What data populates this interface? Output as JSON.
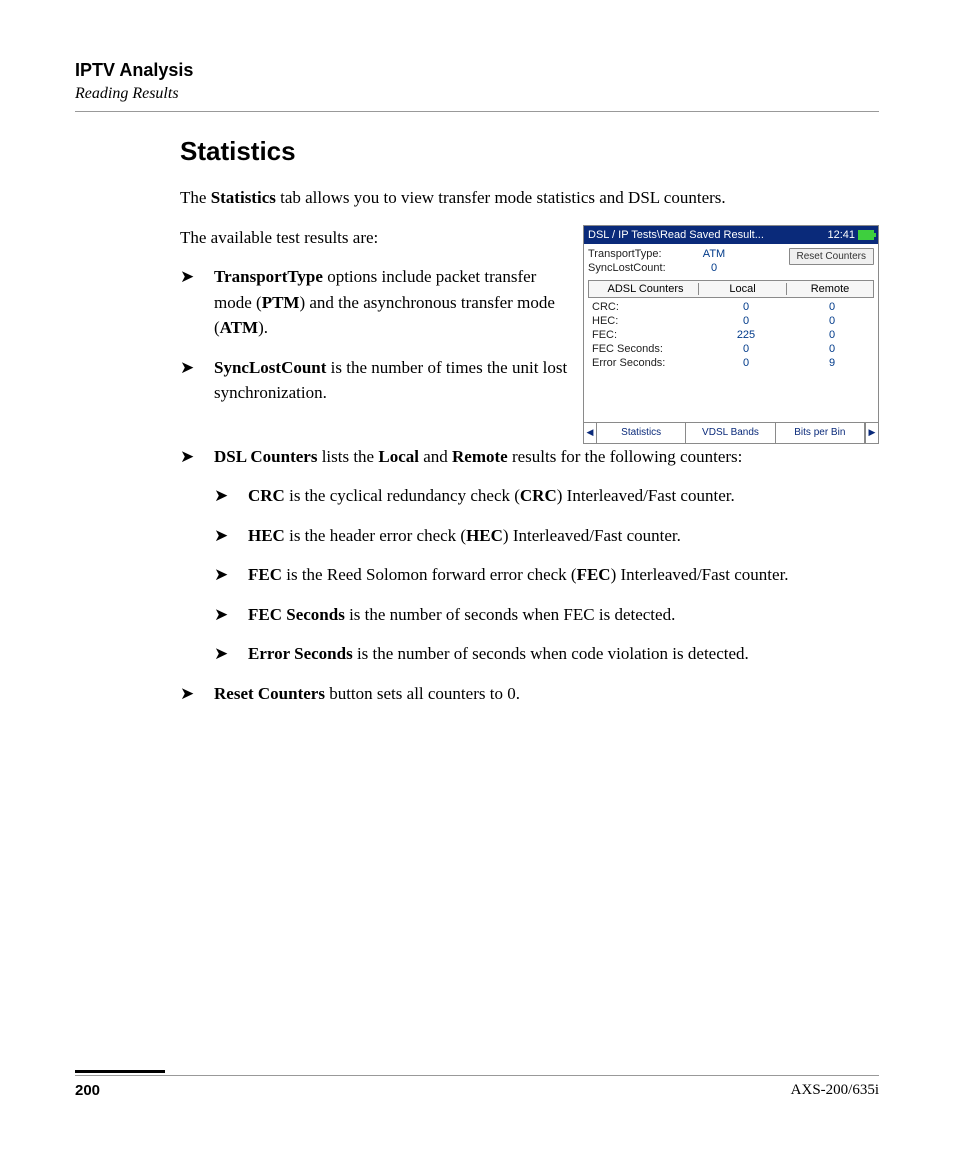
{
  "header": {
    "title": "IPTV Analysis",
    "subtitle": "Reading Results"
  },
  "section": {
    "title": "Statistics",
    "intro_1_a": "The ",
    "intro_1_b": "Statistics",
    "intro_1_c": " tab allows you to view transfer mode statistics and DSL counters.",
    "intro_2": "The available test results are:"
  },
  "bullets": {
    "b1_a": "TransportType",
    "b1_b": " options include packet transfer mode (",
    "b1_c": "PTM",
    "b1_d": ") and the asynchronous transfer mode (",
    "b1_e": "ATM",
    "b1_f": ").",
    "b2_a": "SyncLostCount",
    "b2_b": " is the number of times the unit lost synchronization.",
    "b3_a": "DSL Counters",
    "b3_b": " lists the ",
    "b3_c": "Local",
    "b3_d": " and ",
    "b3_e": "Remote",
    "b3_f": " results for the following counters:",
    "s1_a": "CRC",
    "s1_b": " is the cyclical redundancy check (",
    "s1_c": "CRC",
    "s1_d": ") Interleaved/Fast counter.",
    "s2_a": "HEC",
    "s2_b": " is the header error check (",
    "s2_c": "HEC",
    "s2_d": ") Interleaved/Fast counter.",
    "s3_a": "FEC",
    "s3_b": " is the Reed Solomon forward error check (",
    "s3_c": "FEC",
    "s3_d": ") Interleaved/Fast counter.",
    "s4_a": "FEC Seconds",
    "s4_b": " is the number of seconds when FEC is detected.",
    "s5_a": "Error Seconds",
    "s5_b": " is the number of seconds when code violation is detected.",
    "b4_a": "Reset Counters",
    "b4_b": " button sets all counters to 0."
  },
  "device": {
    "titlebar_left": "DSL / IP Tests\\Read Saved Result...",
    "titlebar_time": "12:41",
    "transport_type_label": "TransportType:",
    "transport_type_value": "ATM",
    "sync_lost_label": "SyncLostCount:",
    "sync_lost_value": "0",
    "reset_btn": "Reset Counters",
    "table_header_name": "ADSL Counters",
    "table_header_local": "Local",
    "table_header_remote": "Remote",
    "rows": [
      {
        "name": "CRC:",
        "local": "0",
        "remote": "0"
      },
      {
        "name": "HEC:",
        "local": "0",
        "remote": "0"
      },
      {
        "name": "FEC:",
        "local": "225",
        "remote": "0"
      },
      {
        "name": "FEC Seconds:",
        "local": "0",
        "remote": "0"
      },
      {
        "name": "Error Seconds:",
        "local": "0",
        "remote": "9"
      }
    ],
    "tabs": {
      "t1": "Statistics",
      "t2": "VDSL Bands",
      "t3": "Bits per Bin"
    }
  },
  "footer": {
    "page": "200",
    "model": "AXS-200/635i"
  }
}
